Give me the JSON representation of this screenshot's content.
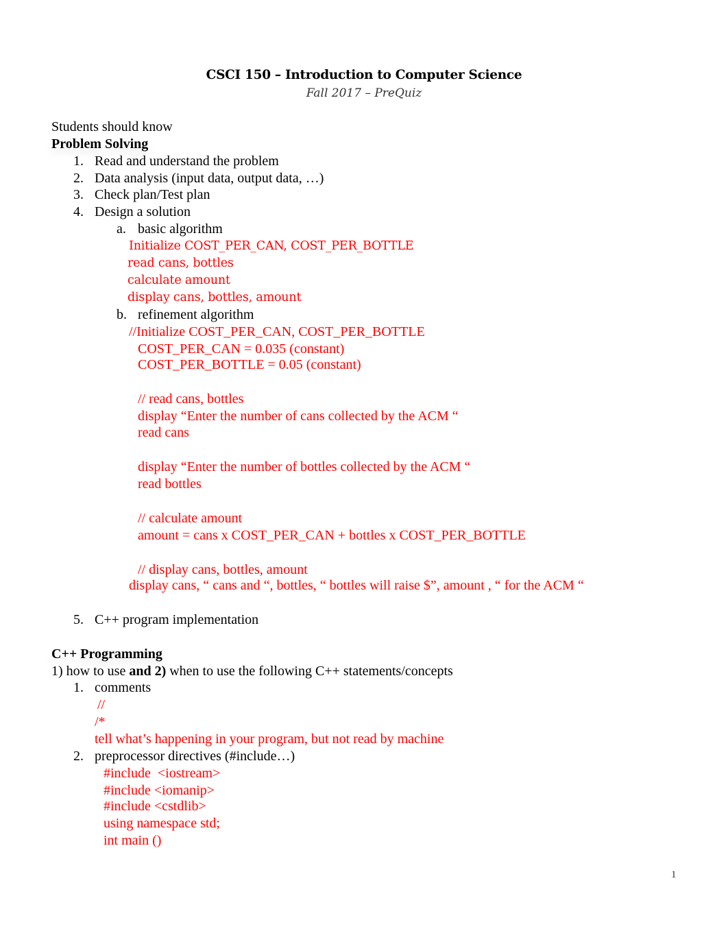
{
  "header": {
    "title": "CSCI 150 – Introduction to Computer Science",
    "subtitle": "Fall 2017 – PreQuiz"
  },
  "intro": "Students should know",
  "problem_solving": {
    "heading": "Problem Solving",
    "steps": [
      {
        "num": "1.",
        "text": "Read and understand the problem"
      },
      {
        "num": "2.",
        "text": "Data analysis (input data, output data, …)"
      },
      {
        "num": "3.",
        "text": "Check plan/Test plan"
      },
      {
        "num": "4.",
        "text": "Design a solution"
      },
      {
        "num": "5.",
        "text": "C++ program implementation"
      }
    ],
    "substeps": [
      {
        "num": "a.",
        "text": "basic algorithm"
      },
      {
        "num": "b.",
        "text": "refinement algorithm"
      }
    ],
    "basic_algorithm": [
      "Initialize COST_PER_CAN, COST_PER_BOTTLE",
      "read cans, bottles",
      "calculate amount",
      "display cans, bottles, amount"
    ],
    "refinement": {
      "init_comment": "//Initialize COST_PER_CAN, COST_PER_BOTTLE",
      "const_can": "COST_PER_CAN = 0.035 (constant)",
      "const_bottle": "COST_PER_BOTTLE = 0.05 (constant)",
      "read_comment": "// read cans, bottles",
      "prompt_cans": "display “Enter the number of cans collected by the ACM “",
      "read_cans": "read cans",
      "prompt_bottles": "display “Enter the number of bottles collected by the ACM “",
      "read_bottles": "read bottles",
      "calc_comment": "// calculate amount",
      "calc_formula": "amount = cans x COST_PER_CAN + bottles x COST_PER_BOTTLE",
      "display_comment": "// display cans, bottles, amount",
      "display_statement": "display cans, “ cans and “, bottles, “ bottles will raise $”, amount , “ for the ACM “"
    }
  },
  "cpp_programming": {
    "heading": "C++ Programming",
    "intro_part1": "1) how to use ",
    "intro_bold": "and 2)",
    "intro_part2": " when to use the following C++ statements/concepts",
    "items": [
      {
        "num": "1.",
        "text": "comments"
      },
      {
        "num": "2.",
        "text": "preprocessor directives (#include…)"
      }
    ],
    "comment_notes": [
      "//",
      "/*",
      "tell what’s happening in your program, but not read by machine"
    ],
    "directive_examples": [
      "#include  <iostream>",
      "#include <iomanip>",
      "#include <cstdlib>",
      "using namespace std;",
      "int main ()"
    ]
  },
  "footer": {
    "page_number": "1"
  },
  "colors": {
    "text": "#000000",
    "annotation": "#ff0000"
  }
}
